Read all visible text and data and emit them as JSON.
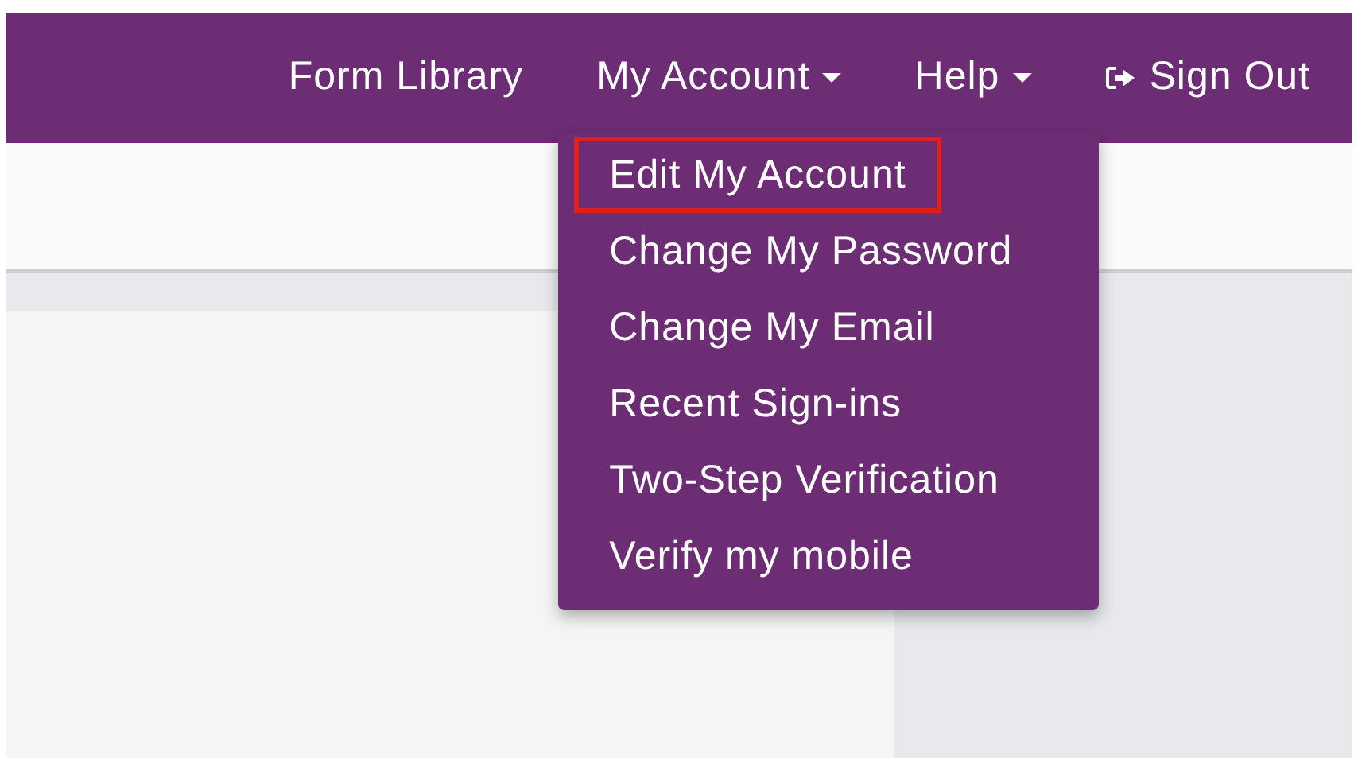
{
  "navbar": {
    "items": [
      {
        "kind": "link",
        "label": "Form Library"
      },
      {
        "kind": "dropdown",
        "label": "My Account"
      },
      {
        "kind": "dropdown",
        "label": "Help"
      },
      {
        "kind": "signout",
        "label": "Sign Out"
      }
    ]
  },
  "account_menu": {
    "items": [
      {
        "label": "Edit My Account",
        "highlighted": true
      },
      {
        "label": "Change My Password",
        "highlighted": false
      },
      {
        "label": "Change My Email",
        "highlighted": false
      },
      {
        "label": "Recent Sign-ins",
        "highlighted": false
      },
      {
        "label": "Two-Step Verification",
        "highlighted": false
      },
      {
        "label": "Verify my mobile",
        "highlighted": false
      }
    ]
  }
}
